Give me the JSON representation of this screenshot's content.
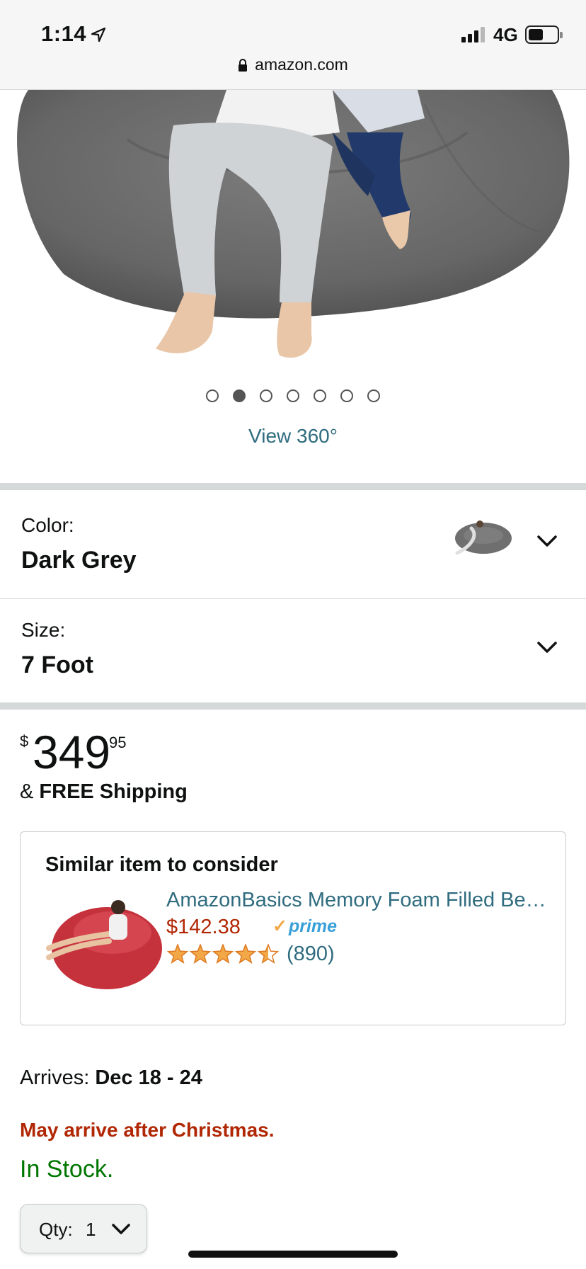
{
  "status_bar": {
    "time": "1:14",
    "network": "4G",
    "location_icon": "location-arrow-icon",
    "signal_icon": "cellular-signal-icon",
    "battery_icon": "battery-icon",
    "battery_level": 0.5
  },
  "browser": {
    "url": "amazon.com",
    "lock_icon": "lock-icon"
  },
  "gallery": {
    "image_count": 7,
    "active_index": 1,
    "view_360_label": "View 360°"
  },
  "variations": {
    "color": {
      "label": "Color:",
      "value": "Dark Grey"
    },
    "size": {
      "label": "Size:",
      "value": "7 Foot"
    }
  },
  "price": {
    "symbol": "$",
    "whole": "349",
    "fraction": "95"
  },
  "shipping": {
    "prefix": "& ",
    "text": "FREE Shipping"
  },
  "similar_item": {
    "heading": "Similar item to consider",
    "name": "AmazonBasics Memory Foam Filled Bean Bag Chair",
    "price": "$142.38",
    "prime_label": "prime",
    "rating": 4.5,
    "review_count": "(890)"
  },
  "delivery": {
    "arrives_label": "Arrives: ",
    "arrives_date": "Dec 18 - 24",
    "warning": "May arrive after Christmas.",
    "stock": "In Stock."
  },
  "quantity": {
    "label": "Qty:",
    "value": "1"
  },
  "colors": {
    "link": "#2f6c7f",
    "price_red": "#b12704",
    "in_stock_green": "#007600",
    "prime_blue": "#3aa0d8",
    "star_orange": "#f3a847",
    "bean_bag_grey": "#6f6f6f",
    "bean_bag_red": "#c5323c"
  }
}
